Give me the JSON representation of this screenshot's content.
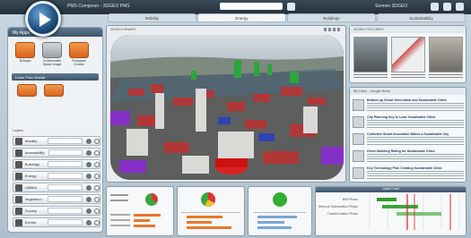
{
  "app": {
    "title": "PMS Composer - 3DGEO PMS",
    "user": "Sonnen 3DGEO",
    "colors": {
      "topbar": "#2a3744",
      "accent": "#e8772b",
      "panel": "#3e5468"
    }
  },
  "tabs": [
    {
      "label": "Mobility"
    },
    {
      "label": "Energy"
    },
    {
      "label": "Buildings"
    },
    {
      "label": "Sustainability"
    }
  ],
  "left_panel": {
    "title": "My Apps",
    "apps": [
      {
        "label": "3DMaps",
        "icon": "person-walking-icon"
      },
      {
        "label": "Collaborative Space Image",
        "icon": "cloud-icon"
      },
      {
        "label": "Pictogram Creator",
        "icon": "person-walking-icon"
      }
    ],
    "section": "Learn From Ahead",
    "layers_label": "Layers",
    "layers": [
      {
        "label": "Mobility",
        "icon": "filter-icon"
      },
      {
        "label": "Accessibility",
        "icon": "road-icon"
      },
      {
        "label": "Buildings",
        "icon": "car-icon"
      },
      {
        "label": "Energy",
        "icon": "bolt-icon"
      },
      {
        "label": "Utilities",
        "icon": "pipe-icon"
      },
      {
        "label": "Vegetation",
        "icon": "pin-icon"
      },
      {
        "label": "Society",
        "icon": "star-icon"
      },
      {
        "label": "Events",
        "icon": "people-icon"
      }
    ]
  },
  "map": {
    "title": "3DGEOVIEWER"
  },
  "photos": {
    "title": "3DGEO PICTURES"
  },
  "news": {
    "title": "My Dash - Google News",
    "items": [
      {
        "headline": "Bottom-up Smart Generation and Sustainable Cities"
      },
      {
        "headline": "City Planning Key to Lead Sustainable Cities"
      },
      {
        "headline": "Collective Smart Innovation Makes a Sustainable City"
      },
      {
        "headline": "Green Building Rating for Sustainable Cities"
      },
      {
        "headline": "Key Technology Plan Creating Sustainable Cities"
      }
    ]
  },
  "gantt": {
    "title": "Gantt Chart",
    "rows": [
      {
        "label": "BIM Phase"
      },
      {
        "label": "Network Optimization Phase"
      },
      {
        "label": "Transformation Phase"
      }
    ]
  }
}
